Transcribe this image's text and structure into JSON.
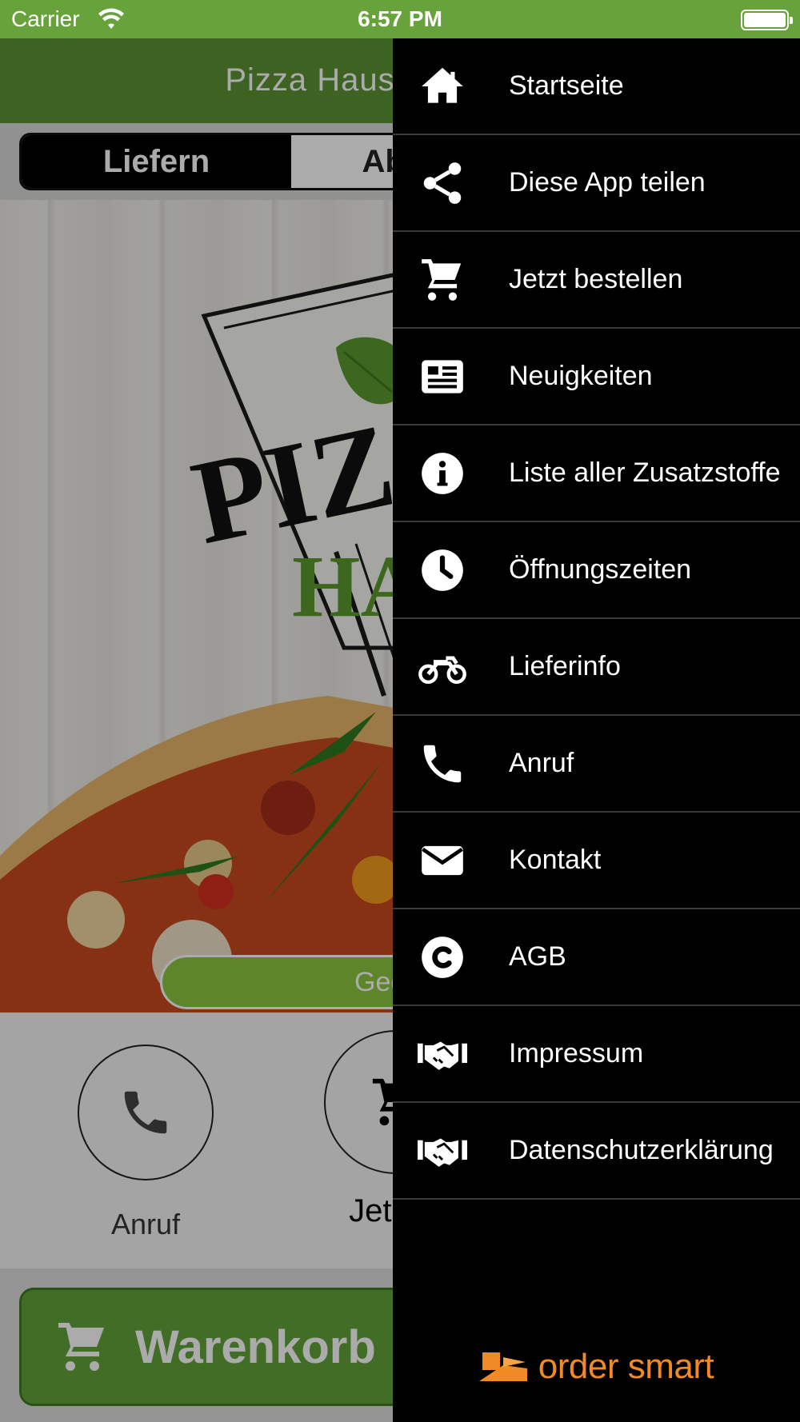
{
  "status_bar": {
    "carrier": "Carrier",
    "time": "6:57 PM"
  },
  "app": {
    "title": "Pizza Haus",
    "segments": [
      {
        "label": "Liefern",
        "active": true
      },
      {
        "label": "Abholen",
        "active": false
      }
    ],
    "logo_text": {
      "line1": "PIZ",
      "line2": "HA"
    },
    "status_pill": "Geö",
    "quick_actions": [
      {
        "label": "Anruf",
        "icon": "phone-icon"
      },
      {
        "label": "Jetzt b",
        "icon": "cart-icon"
      }
    ],
    "cart_button": {
      "label": "Warenkorb",
      "icon": "cart-icon"
    },
    "colors": {
      "header": "#5b9233",
      "accent": "#8cc63f"
    }
  },
  "menu": {
    "items": [
      {
        "label": "Startseite",
        "icon": "home-icon"
      },
      {
        "label": "Diese App teilen",
        "icon": "share-icon"
      },
      {
        "label": "Jetzt bestellen",
        "icon": "cart-icon"
      },
      {
        "label": "Neuigkeiten",
        "icon": "newspaper-icon"
      },
      {
        "label": "Liste aller Zusatzstoffe",
        "icon": "info-icon"
      },
      {
        "label": "Öffnungszeiten",
        "icon": "clock-icon"
      },
      {
        "label": "Lieferinfo",
        "icon": "motorcycle-icon"
      },
      {
        "label": "Anruf",
        "icon": "phone-icon"
      },
      {
        "label": "Kontakt",
        "icon": "envelope-icon"
      },
      {
        "label": "AGB",
        "icon": "copyright-icon"
      },
      {
        "label": "Impressum",
        "icon": "handshake-icon"
      },
      {
        "label": "Datenschutzerklärung",
        "icon": "handshake-icon"
      }
    ],
    "brand": "order smart",
    "colors": {
      "background": "#000000",
      "brand": "#f08a24"
    }
  }
}
